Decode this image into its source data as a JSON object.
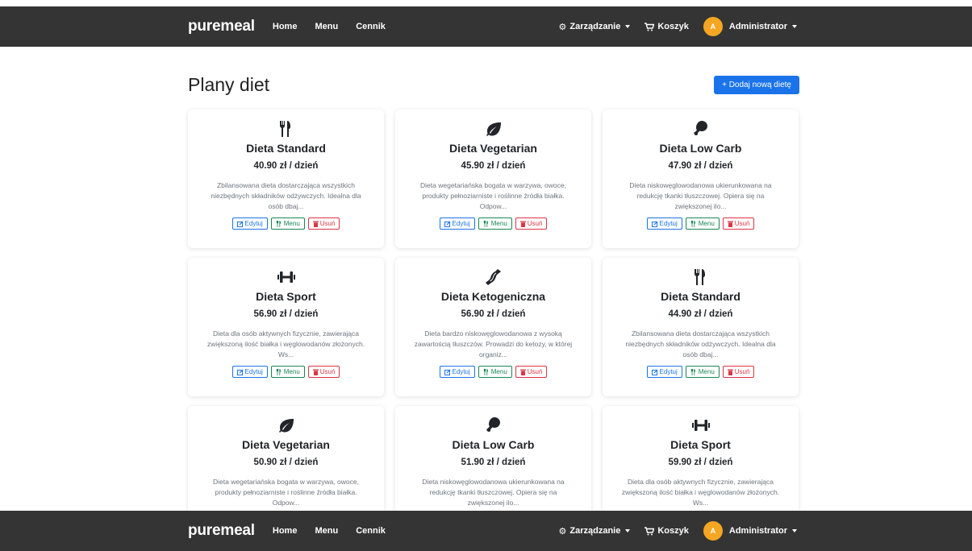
{
  "navbar": {
    "brand": "puremeal",
    "links": [
      "Home",
      "Menu",
      "Cennik"
    ],
    "management_label": "Zarządzanie",
    "cart_label": "Koszyk",
    "avatar_letter": "A",
    "user_label": "Administrator"
  },
  "page": {
    "title": "Plany diet",
    "add_button": "+ Dodaj nową dietę"
  },
  "actions": {
    "edit": "Edytuj",
    "menu": "Menu",
    "delete": "Usuń"
  },
  "diets": [
    {
      "icon": "utensils-icon",
      "name": "Dieta Standard",
      "price": "40.90 zł / dzień",
      "description": "Zbilansowana dieta dostarczająca wszystkich niezbędnych składników odżywczych. Idealna dla osób dbaj..."
    },
    {
      "icon": "leaf-icon",
      "name": "Dieta Vegetarian",
      "price": "45.90 zł / dzień",
      "description": "Dieta wegetariańska bogata w warzywa, owoce, produkty pełnoziarniste i roślinne źródła białka. Odpow..."
    },
    {
      "icon": "drumstick-icon",
      "name": "Dieta Low Carb",
      "price": "47.90 zł / dzień",
      "description": "Dieta niskowęglowodanowa ukierunkowana na redukcję tkanki tłuszczowej. Opiera się na zwiększonej ilo..."
    },
    {
      "icon": "dumbbell-icon",
      "name": "Dieta Sport",
      "price": "56.90 zł / dzień",
      "description": "Dieta dla osób aktywnych fizycznie, zawierająca zwiększoną ilość białka i węglowodanów złożonych. Ws..."
    },
    {
      "icon": "bacon-icon",
      "name": "Dieta Ketogeniczna",
      "price": "56.90 zł / dzień",
      "description": "Dieta bardzo niskowęglowodanowa z wysoką zawartością tłuszczów. Prowadzi do ketozy, w której organiz..."
    },
    {
      "icon": "utensils-icon",
      "name": "Dieta Standard",
      "price": "44.90 zł / dzień",
      "description": "Zbilansowana dieta dostarczająca wszystkich niezbędnych składników odżywczych. Idealna dla osób dbaj..."
    },
    {
      "icon": "leaf-icon",
      "name": "Dieta Vegetarian",
      "price": "50.90 zł / dzień",
      "description": "Dieta wegetariańska bogata w warzywa, owoce, produkty pełnoziarniste i roślinne źródła białka. Odpow..."
    },
    {
      "icon": "drumstick-icon",
      "name": "Dieta Low Carb",
      "price": "51.90 zł / dzień",
      "description": "Dieta niskowęglowodanowa ukierunkowana na redukcję tkanki tłuszczowej. Opiera się na zwiększonej ilo..."
    },
    {
      "icon": "dumbbell-icon",
      "name": "Dieta Sport",
      "price": "59.90 zł / dzień",
      "description": "Dieta dla osób aktywnych fizycznie, zawierająca zwiększoną ilość białka i węglowodanów złożonych. Ws..."
    }
  ],
  "colors": {
    "navbar_bg": "#343434",
    "primary": "#1a73e8",
    "success": "#198754",
    "danger": "#dc3545",
    "avatar": "#f5a623"
  }
}
